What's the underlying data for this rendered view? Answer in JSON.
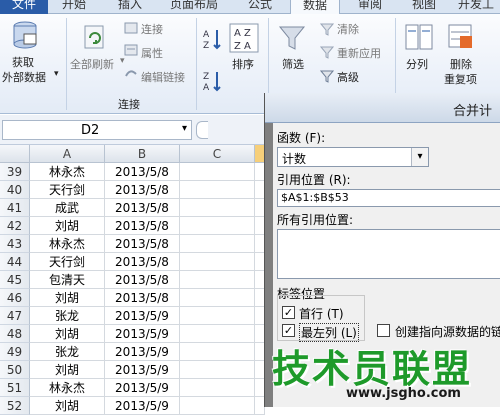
{
  "ribbon": {
    "tabs": {
      "file": "文件",
      "start": "开始",
      "insert": "插入",
      "layout": "页面布局",
      "formula": "公式",
      "data": "数据",
      "review": "审阅",
      "view": "视图",
      "dev": "开发工"
    },
    "get_data_line1": "获取",
    "get_data_line2": "外部数据",
    "refresh_all": "全部刷新",
    "connections": "连接",
    "properties": "属性",
    "edit_links": "编辑链接",
    "group_connections": "连接",
    "sort": "排序",
    "filter": "筛选",
    "clear": "清除",
    "reapply": "重新应用",
    "advanced": "高级",
    "text_to_columns": "分列",
    "remove_dup_line1": "删除",
    "remove_dup_line2": "重复项"
  },
  "formula_bar": {
    "name_box": "D2"
  },
  "sheet": {
    "columns": [
      "A",
      "B",
      "C"
    ],
    "rows": [
      {
        "num": "39",
        "name": "林永杰",
        "date": "2013/5/8"
      },
      {
        "num": "40",
        "name": "天行剑",
        "date": "2013/5/8"
      },
      {
        "num": "41",
        "name": "成武",
        "date": "2013/5/8"
      },
      {
        "num": "42",
        "name": "刘胡",
        "date": "2013/5/8"
      },
      {
        "num": "43",
        "name": "林永杰",
        "date": "2013/5/8"
      },
      {
        "num": "44",
        "name": "天行剑",
        "date": "2013/5/8"
      },
      {
        "num": "45",
        "name": "包清天",
        "date": "2013/5/8"
      },
      {
        "num": "46",
        "name": "刘胡",
        "date": "2013/5/8"
      },
      {
        "num": "47",
        "name": "张龙",
        "date": "2013/5/9"
      },
      {
        "num": "48",
        "name": "刘胡",
        "date": "2013/5/9"
      },
      {
        "num": "49",
        "name": "张龙",
        "date": "2013/5/9"
      },
      {
        "num": "50",
        "name": "刘胡",
        "date": "2013/5/9"
      },
      {
        "num": "51",
        "name": "林永杰",
        "date": "2013/5/9"
      },
      {
        "num": "52",
        "name": "刘胡",
        "date": "2013/5/9"
      }
    ]
  },
  "dialog": {
    "title": "合并计",
    "function_label": "函数 (F):",
    "function_value": "计数",
    "ref_label": "引用位置 (R):",
    "ref_value": "$A$1:$B$53",
    "all_refs_label": "所有引用位置:",
    "label_pos": "标签位置",
    "top_row": "首行 (T)",
    "left_col": "最左列 (L)",
    "link_source": "创建指向源数据的链"
  },
  "watermark": {
    "main": "技术员联盟",
    "url": "www.jsgho.com"
  },
  "colors": {
    "accent": "#2a5ca8",
    "watermark": "#1e9a2a",
    "dialog_bg": "#f0f0f0"
  }
}
